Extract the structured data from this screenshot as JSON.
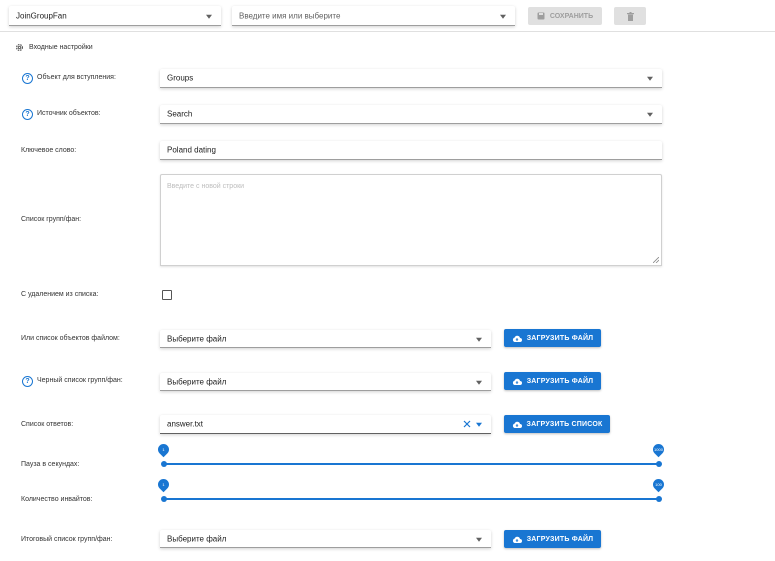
{
  "toolbar": {
    "module_select_value": "JoinGroupFan",
    "account_select_placeholder": "Введите имя или выберите",
    "save_label": "СОХРАНИТЬ"
  },
  "section_title": "Входные настройки",
  "fields": {
    "object_type": {
      "label": "Объект для вступления:",
      "value": "Groups"
    },
    "source": {
      "label": "Источник объектов:",
      "value": "Search"
    },
    "keyword": {
      "label": "Ключевое слово:",
      "value": "Poland dating"
    },
    "group_list": {
      "label": "Список групп/фан:",
      "placeholder": "Введите с новой строки"
    },
    "delete_from_list": {
      "label": "С удалением из списка:",
      "checked": false
    },
    "objects_file": {
      "label": "Или список объектов файлом:",
      "value": "Выберите файл",
      "button": "ЗАГРУЗИТЬ ФАЙЛ"
    },
    "blacklist": {
      "label": "Черный список групп/фан:",
      "value": "Выберите файл",
      "button": "ЗАГРУЗИТЬ ФАЙЛ"
    },
    "answers": {
      "label": "Список ответов:",
      "value": "answer.txt",
      "button": "ЗАГРУЗИТЬ СПИСОК"
    },
    "pause": {
      "label": "Пауза в секундах:",
      "min": 1,
      "max": 1000
    },
    "invites": {
      "label": "Количество инвайтов:",
      "min": 1,
      "max": 100
    },
    "result_list": {
      "label": "Итоговый список групп/фан:",
      "value": "Выберите файл",
      "button": "ЗАГРУЗИТЬ ФАЙЛ"
    }
  },
  "colors": {
    "primary": "#1976d2",
    "disabled_bg": "#e0e0e0"
  }
}
